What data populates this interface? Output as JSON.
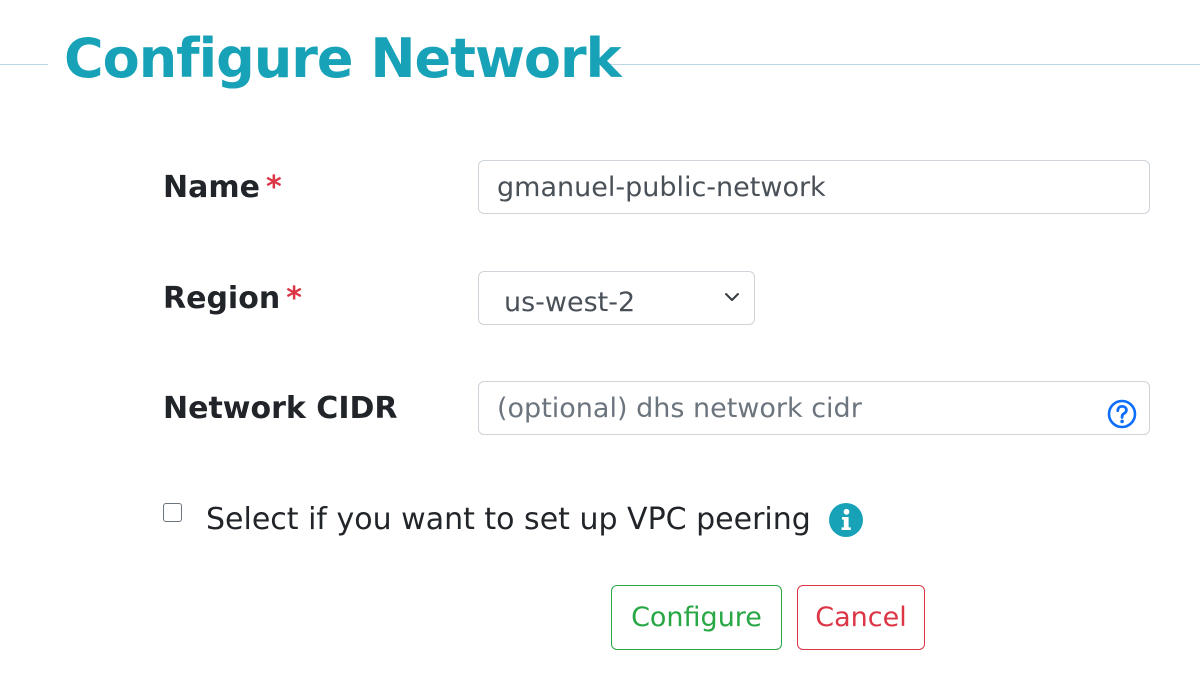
{
  "title": "Configure Network",
  "form": {
    "name": {
      "label": "Name",
      "required_mark": "*",
      "value": "gmanuel-public-network"
    },
    "region": {
      "label": "Region",
      "required_mark": "*",
      "selected": "us-west-2"
    },
    "network_cidr": {
      "label": "Network CIDR",
      "placeholder": "(optional) dhs network cidr",
      "value": "",
      "help_icon": "question-circle-icon"
    },
    "vpc_peering": {
      "label": "Select if you want to set up VPC peering",
      "checked": false,
      "info_icon": "info-circle-icon"
    }
  },
  "buttons": {
    "configure": "Configure",
    "cancel": "Cancel"
  },
  "colors": {
    "title": "#17a2b8",
    "required": "#dc3545",
    "configure": "#28a745",
    "cancel": "#dc3545",
    "help_icon": "#0d6efd",
    "info_icon": "#17a2b8"
  }
}
